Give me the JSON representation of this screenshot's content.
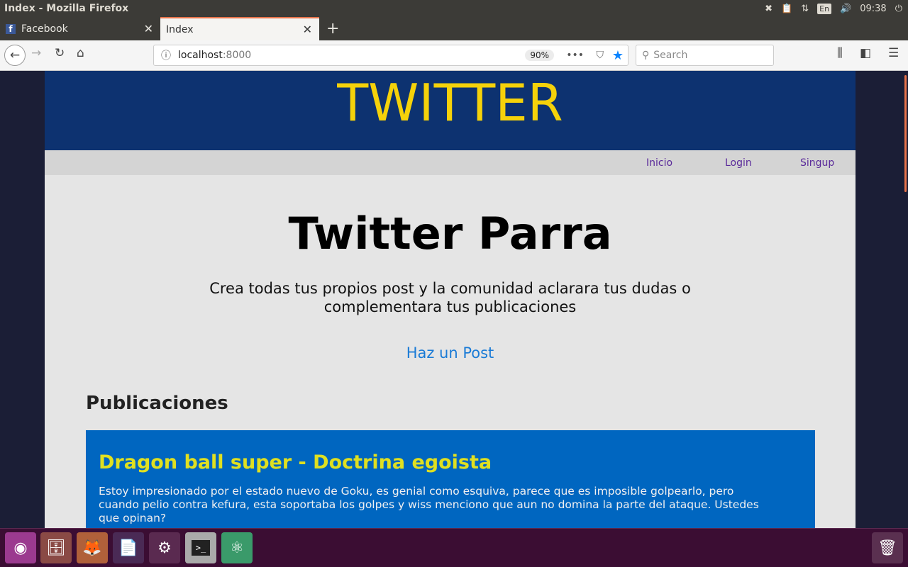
{
  "window": {
    "title": "Index - Mozilla Firefox",
    "clock": "09:38",
    "keyboard": "En"
  },
  "tabs": [
    {
      "label": "Facebook"
    },
    {
      "label": "Index"
    }
  ],
  "toolbar": {
    "url_host": "localhost",
    "url_port": ":8000",
    "zoom": "90%",
    "search_placeholder": "Search"
  },
  "site": {
    "brand": "TWITTER",
    "nav": [
      "Inicio",
      "Login",
      "Singup"
    ],
    "title": "Twitter Parra",
    "subtitle": "Crea todas tus propios post y la comunidad aclarara tus dudas o complementara tus publicaciones",
    "cta": "Haz un Post",
    "section": "Publicaciones"
  },
  "posts": [
    {
      "title": "Dragon ball super - Doctrina egoista",
      "body": "Estoy impresionado por el estado nuevo de Goku, es genial como esquiva, parece que es imposible golpearlo, pero cuando pelio contra kefura, esta soportaba los golpes y wiss menciono que aun no domina la parte del ataque. Ustedes que opinan?"
    }
  ],
  "colors": {
    "header": "#0d3270",
    "brand": "#f5d20a",
    "card": "#0066c0",
    "card_title": "#e0e020"
  }
}
